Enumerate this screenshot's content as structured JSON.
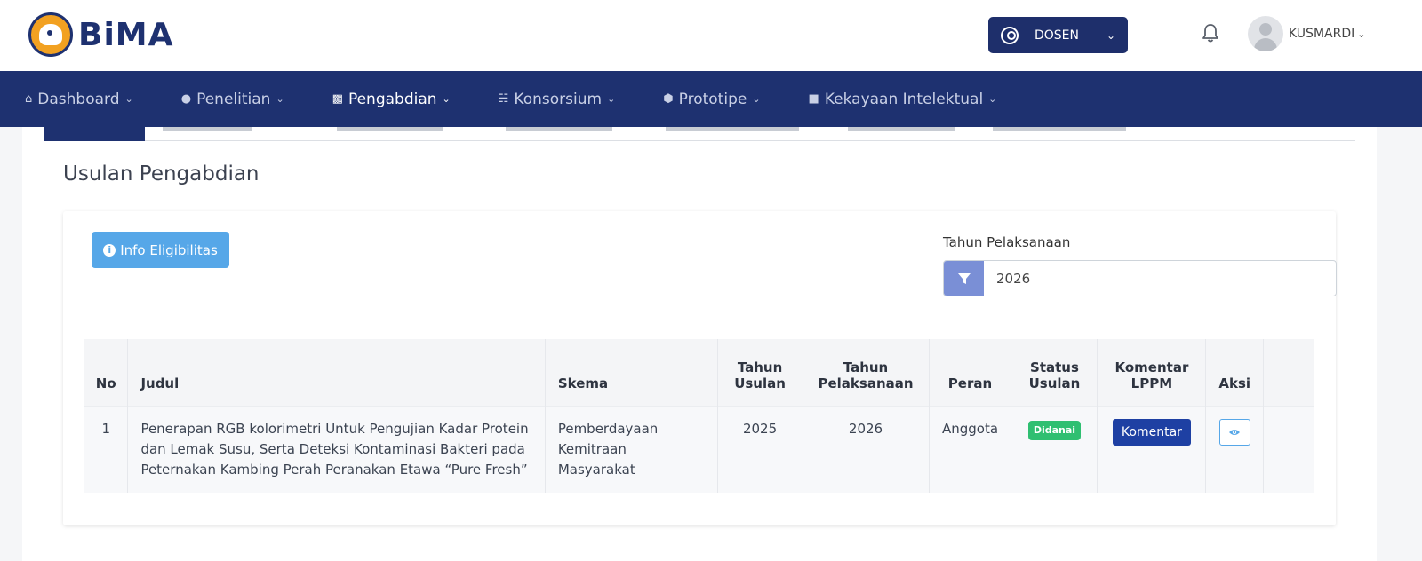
{
  "header": {
    "logo_text": "BiMA",
    "role_label": "DOSEN",
    "user_name": "KUSMARDI"
  },
  "nav": [
    {
      "label": "Dashboard",
      "icon": "home-icon"
    },
    {
      "label": "Penelitian",
      "icon": "search-icon"
    },
    {
      "label": "Pengabdian",
      "icon": "document-icon"
    },
    {
      "label": "Konsorsium",
      "icon": "network-icon"
    },
    {
      "label": "Prototipe",
      "icon": "box-icon"
    },
    {
      "label": "Kekayaan Intelektual",
      "icon": "lock-icon"
    }
  ],
  "page": {
    "title": "Usulan Pengabdian",
    "info_button": "Info Eligibilitas",
    "filter_label": "Tahun Pelaksanaan",
    "filter_value": "2026"
  },
  "table": {
    "headers": {
      "no": "No",
      "judul": "Judul",
      "skema": "Skema",
      "tahun_usulan_1": "Tahun",
      "tahun_usulan_2": "Usulan",
      "tahun_pelaksanaan_1": "Tahun",
      "tahun_pelaksanaan_2": "Pelaksanaan",
      "peran": "Peran",
      "status_1": "Status",
      "status_2": "Usulan",
      "komentar_1": "Komentar",
      "komentar_2": "LPPM",
      "aksi": "Aksi"
    },
    "rows": [
      {
        "no": "1",
        "judul": "Penerapan RGB kolorimetri Untuk Pengujian Kadar Protein dan Lemak Susu, Serta Deteksi Kontaminasi Bakteri pada Peternakan Kambing Perah Peranakan Etawa “Pure Fresh”",
        "skema": "Pemberdayaan Kemitraan Masyarakat",
        "tahun_usulan": "2025",
        "tahun_pelaksanaan": "2026",
        "peran": "Anggota",
        "status": "Didanai",
        "komentar_button": "Komentar"
      }
    ]
  },
  "colors": {
    "primary_navy": "#1e3170",
    "info_blue": "#56a7e8",
    "status_green": "#2fbf71",
    "filter_button": "#7a8fd6",
    "komentar_button": "#1e40a3"
  }
}
